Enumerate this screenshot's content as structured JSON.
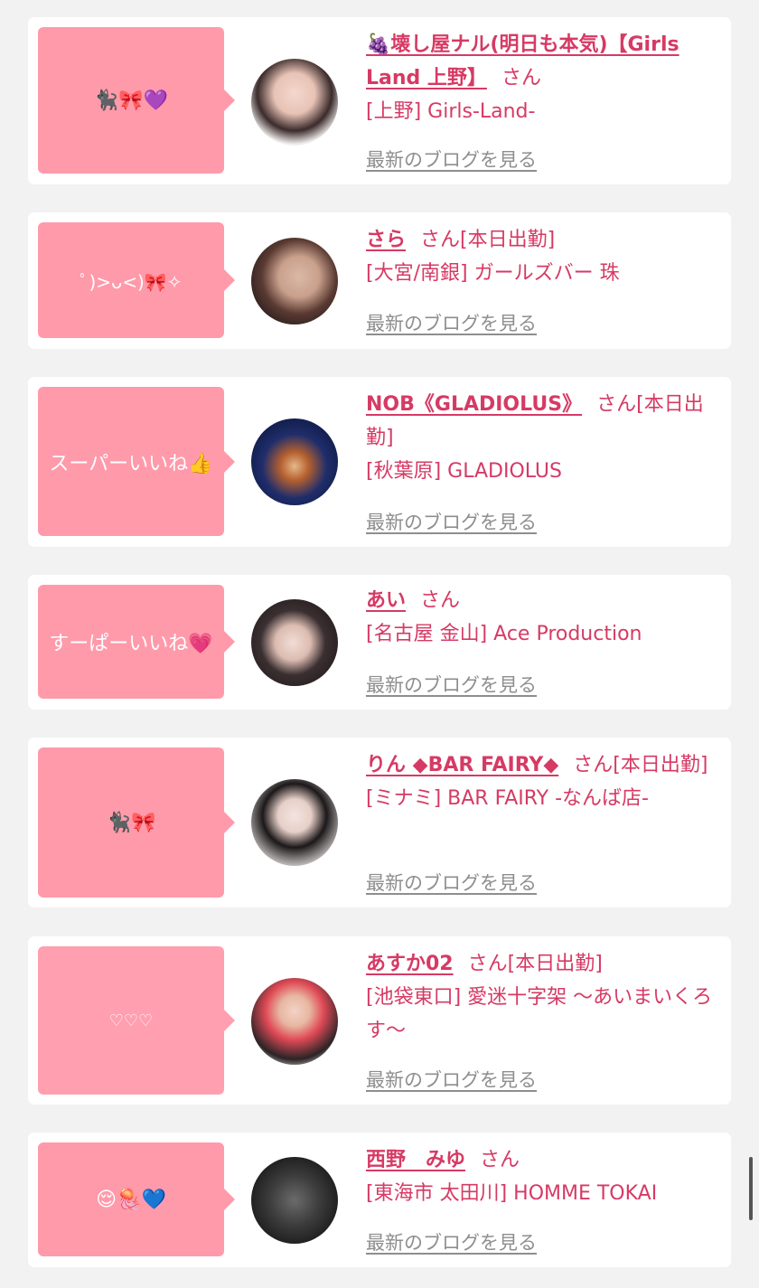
{
  "blog_link_label": "最新のブログを見る",
  "san": "さん",
  "cards": [
    {
      "comment": "🐈‍⬛🎀💜",
      "name": "🍇壊し屋ナル(明日も本気)【Girls Land 上野】",
      "status": "",
      "shop": "[上野] Girls-Land-"
    },
    {
      "comment": "ﾟ)>ᴗ<)🎀✧",
      "name": "さら",
      "status": "[本日出勤]",
      "shop": "[大宮/南銀] ガールズバー 珠"
    },
    {
      "comment": "スーパーいいね👍",
      "name": "NOB《GLADIOLUS》",
      "status": "[本日出勤]",
      "shop": "[秋葉原] GLADIOLUS"
    },
    {
      "comment": "すーぱーいいね💗",
      "name": "あい",
      "status": "",
      "shop": "[名古屋 金山] Ace Production"
    },
    {
      "comment": "🐈‍⬛🎀",
      "name": "りん ◆BAR FAIRY◆",
      "status": "[本日出勤]",
      "shop": "[ミナミ] BAR FAIRY -なんば店-"
    },
    {
      "comment": "♡♡♡",
      "name": "あすか02",
      "status": "[本日出勤]",
      "shop": "[池袋東口] 愛迷十字架 〜あいまいくろす〜"
    },
    {
      "comment": "😌🪼💙",
      "name": "西野　みゆ",
      "status": "",
      "shop": "[東海市 太田川] HOMME TOKAI"
    }
  ]
}
